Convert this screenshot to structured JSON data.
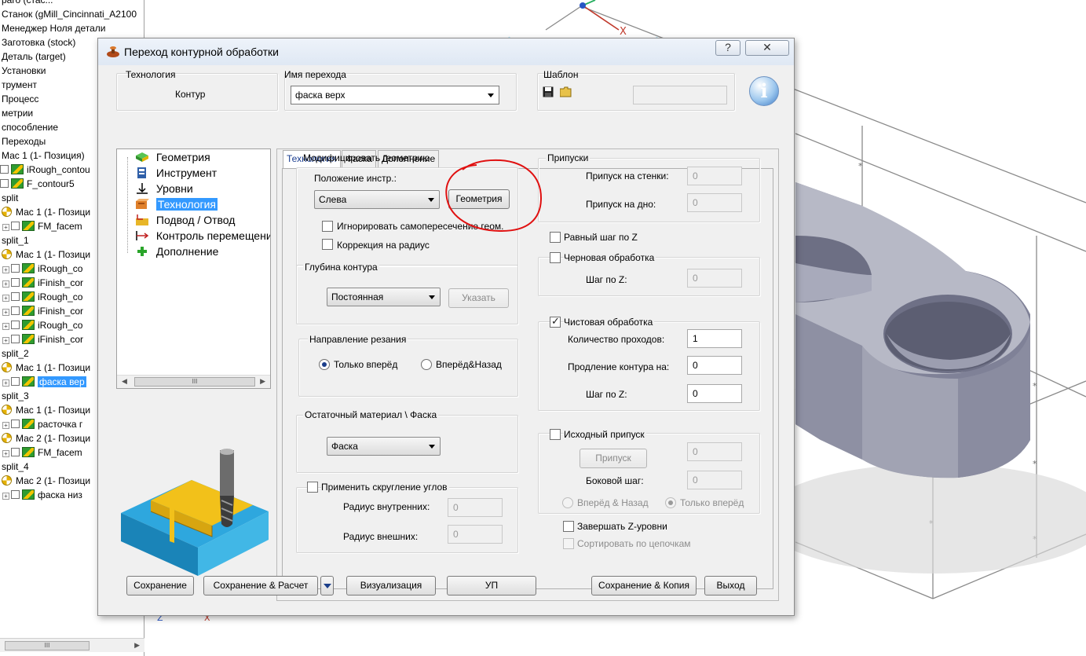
{
  "cam_tree": {
    "rows": [
      {
        "text": "раго (стас...",
        "kind": "text"
      },
      {
        "text": "Станок (gMill_Cincinnati_A2100",
        "kind": "text"
      },
      {
        "text": "Менеджер Ноля детали",
        "kind": "text"
      },
      {
        "text": "Заготовка (stock)",
        "kind": "text"
      },
      {
        "text": "Деталь (target)",
        "kind": "text"
      },
      {
        "text": "Установки",
        "kind": "text"
      },
      {
        "text": "трумент",
        "kind": "text"
      },
      {
        "text": "Процесс",
        "kind": "text"
      },
      {
        "text": "метрии",
        "kind": "text"
      },
      {
        "text": "способление",
        "kind": "text"
      },
      {
        "text": "Переходы",
        "kind": "text"
      },
      {
        "text": "Мас 1 (1- Позиция)",
        "kind": "text"
      },
      {
        "text": "iRough_contou",
        "kind": "op"
      },
      {
        "text": "F_contour5",
        "kind": "op"
      },
      {
        "text": "split",
        "kind": "text"
      },
      {
        "text": "Мас 1 (1- Позици",
        "kind": "pos"
      },
      {
        "text": "FM_facem",
        "kind": "op-plus"
      },
      {
        "text": "split_1",
        "kind": "text"
      },
      {
        "text": "Мас 1 (1- Позици",
        "kind": "pos"
      },
      {
        "text": "iRough_co",
        "kind": "op-plus"
      },
      {
        "text": "iFinish_cor",
        "kind": "op-plus"
      },
      {
        "text": "iRough_co",
        "kind": "op-plus"
      },
      {
        "text": "iFinish_cor",
        "kind": "op-plus"
      },
      {
        "text": "iRough_co",
        "kind": "op-plus"
      },
      {
        "text": "iFinish_cor",
        "kind": "op-plus"
      },
      {
        "text": "split_2",
        "kind": "text"
      },
      {
        "text": "Мас 1 (1- Позици",
        "kind": "pos"
      },
      {
        "text": "фаска вер",
        "kind": "op-plus-sel"
      },
      {
        "text": "split_3",
        "kind": "text"
      },
      {
        "text": "Мас 1 (1- Позици",
        "kind": "pos"
      },
      {
        "text": "расточка г",
        "kind": "op-plus"
      },
      {
        "text": "Мас 2 (1- Позици",
        "kind": "pos"
      },
      {
        "text": "FM_facem",
        "kind": "op-plus"
      },
      {
        "text": "split_4",
        "kind": "text"
      },
      {
        "text": "Мас 2 (1- Позици",
        "kind": "pos"
      },
      {
        "text": "фаска низ",
        "kind": "op-plus"
      }
    ],
    "scroll_thumb": "III"
  },
  "dialog": {
    "title": "Переход контурной обработки",
    "help_label": "?",
    "close_label": "✕",
    "technology": {
      "label": "Технология",
      "value": "Контур"
    },
    "op_name": {
      "label": "Имя перехода",
      "value": "фаска верх"
    },
    "template": {
      "label": "Шаблон",
      "value": ""
    },
    "info_label": "i",
    "op_tree": {
      "items": [
        "Геометрия",
        "Инструмент",
        "Уровни",
        "Технология",
        "Подвод / Отвод",
        "Контроль перемещений",
        "Дополнение"
      ],
      "selected_index": 3,
      "scroll_thumb": "III"
    },
    "tabs": [
      "Технология",
      "Фаска",
      "Дополнение"
    ],
    "active_tab": "Технология",
    "modify_geometry": {
      "label": "Модифицировать геометрию",
      "tool_position_label": "Положение инстр.:",
      "tool_position_value": "Слева",
      "geometry_button": "Геометрия",
      "ignore_self_intersection": {
        "label": "Игнорировать самопересечение геом.",
        "checked": false
      },
      "radius_correction": {
        "label": "Коррекция на радиус",
        "checked": false
      }
    },
    "contour_depth": {
      "label": "Глубина контура",
      "value": "Постоянная",
      "specify_button": "Указать"
    },
    "cut_direction": {
      "label": "Направление резания",
      "options": [
        "Только вперёд",
        "Вперёд&Назад"
      ],
      "selected": "Только вперёд"
    },
    "residual": {
      "label": "Остаточный материал \\ Фаска",
      "value": "Фаска"
    },
    "corner_rounding": {
      "label": "Применить скругление углов",
      "checked": false,
      "inner_radius_label": "Радиус внутренних:",
      "inner_radius_value": "0",
      "outer_radius_label": "Радиус внешних:",
      "outer_radius_value": "0"
    },
    "allowances": {
      "label": "Припуски",
      "wall_label": "Припуск на стенки:",
      "wall_value": "0",
      "floor_label": "Припуск на дно:",
      "floor_value": "0"
    },
    "equal_z_step": {
      "label": "Равный шаг по Z",
      "checked": false
    },
    "roughing": {
      "label": "Черновая обработка",
      "checked": false,
      "z_step_label": "Шаг по Z:",
      "z_step_value": "0"
    },
    "finishing": {
      "label": "Чистовая обработка",
      "checked": true,
      "passes_label": "Количество проходов:",
      "passes_value": "1",
      "extension_label": "Продление контура на:",
      "extension_value": "0",
      "z_step_label": "Шаг по Z:",
      "z_step_value": "0"
    },
    "initial_allowance": {
      "label": "Исходный припуск",
      "checked": false,
      "allowance_button": "Припуск",
      "allowance_value": "0",
      "side_step_label": "Боковой шаг:",
      "side_step_value": "0",
      "options": [
        "Вперёд & Назад",
        "Только вперёд"
      ],
      "selected": "Только вперёд"
    },
    "finish_z_levels": {
      "label": "Завершать Z-уровни",
      "checked": false
    },
    "sort_by_chains": {
      "label": "Сортировать по цепочкам",
      "checked": false
    },
    "footer": {
      "save": "Сохранение",
      "save_calc": "Сохранение & Расчет",
      "visualize": "Визуализация",
      "nc": "УП",
      "save_copy": "Сохранение & Копия",
      "exit": "Выход"
    }
  },
  "colors": {
    "selection": "#3399ff",
    "annotation": "#e01010",
    "part_body": "#9a9cab"
  }
}
